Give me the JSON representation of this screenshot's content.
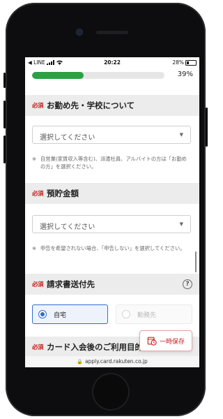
{
  "status_bar": {
    "back_app": "◀ LINE",
    "time": "20:22",
    "battery": "28%"
  },
  "progress": {
    "fraction": 0.39,
    "label": "39%",
    "color": "#2ba143"
  },
  "required_badge": "必須",
  "sections": {
    "workplace": {
      "title": "お勤め先・学校について",
      "select_value": "選択してください",
      "note_mark": "※",
      "note": "自営業(家賃収入等含む)、派遣社員、アルバイトの方は「お勤めの方」を選択ください。"
    },
    "savings": {
      "title": "預貯金額",
      "select_value": "選択してください",
      "note_mark": "※",
      "note": "申告を希望されない場合、「申告しない」を選択してください。"
    },
    "billing": {
      "title": "請求書送付先",
      "help_icon": "question-circle-icon",
      "help_glyph": "?",
      "options": [
        {
          "label": "自宅",
          "selected": true
        },
        {
          "label": "勤務先",
          "selected": false
        }
      ]
    },
    "usage": {
      "title": "カード入会後のご利用目的（複数回答"
    }
  },
  "save_button": {
    "label": "一時保存",
    "icon": "save-clock-icon"
  },
  "url_bar": {
    "lock_icon": "lock-icon",
    "lock_glyph": "🔒",
    "url": "apply.card.rakuten.co.jp"
  },
  "colors": {
    "required_red": "#c81e1e",
    "selected_blue": "#2f6bd3",
    "save_red": "#c82020"
  }
}
